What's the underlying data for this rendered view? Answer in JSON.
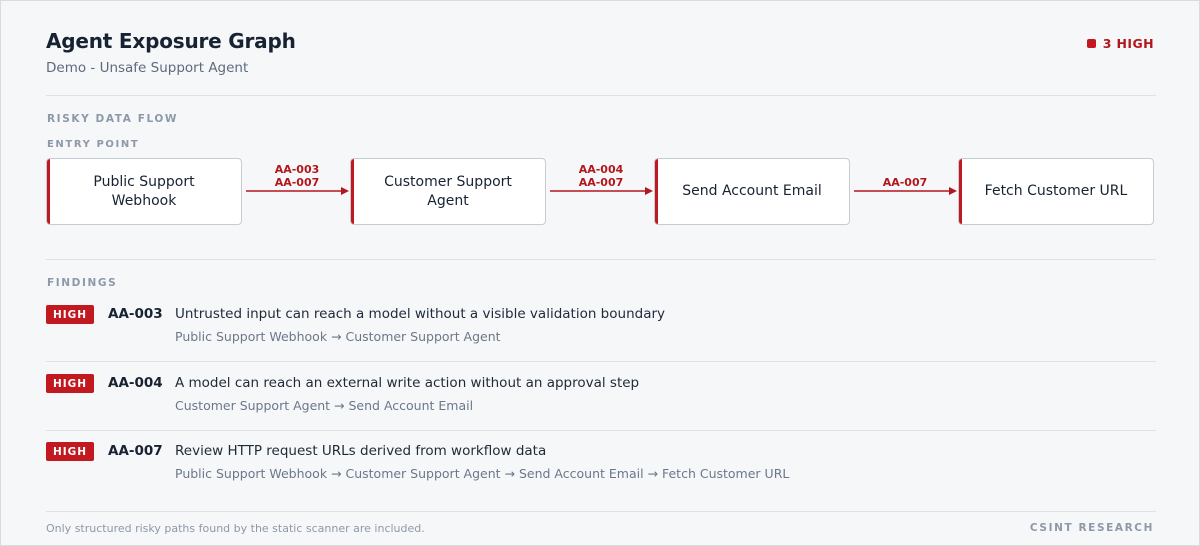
{
  "header": {
    "title": "Agent Exposure Graph",
    "subtitle": "Demo - Unsafe Support Agent",
    "summary": "3 HIGH"
  },
  "flow": {
    "section_label": "RISKY DATA FLOW",
    "entry_label": "ENTRY POINT",
    "nodes": [
      {
        "label": "Public Support Webhook"
      },
      {
        "label": "Customer Support Agent"
      },
      {
        "label": "Send Account Email"
      },
      {
        "label": "Fetch Customer URL"
      }
    ],
    "edges": [
      {
        "from": "Public Support Webhook",
        "to": "Customer Support Agent",
        "codes": [
          "AA-003",
          "AA-007"
        ]
      },
      {
        "from": "Customer Support Agent",
        "to": "Send Account Email",
        "codes": [
          "AA-004",
          "AA-007"
        ]
      },
      {
        "from": "Send Account Email",
        "to": "Fetch Customer URL",
        "codes": [
          "AA-007"
        ]
      }
    ]
  },
  "findings": {
    "section_label": "FINDINGS",
    "items": [
      {
        "severity": "HIGH",
        "id": "AA-003",
        "description": "Untrusted input can reach a model without a visible validation boundary",
        "path": "Public Support Webhook → Customer Support Agent"
      },
      {
        "severity": "HIGH",
        "id": "AA-004",
        "description": "A model can reach an external write action without an approval step",
        "path": "Customer Support Agent → Send Account Email"
      },
      {
        "severity": "HIGH",
        "id": "AA-007",
        "description": "Review HTTP request URLs derived from workflow data",
        "path": "Public Support Webhook → Customer Support Agent → Send Account Email → Fetch Customer URL"
      }
    ]
  },
  "footer": {
    "note": "Only structured risky paths found by the static scanner are included.",
    "brand": "CSINT RESEARCH"
  },
  "colors": {
    "risk": "#c1191f",
    "background": "#f6f7f9",
    "node_fill": "#ffffff"
  }
}
